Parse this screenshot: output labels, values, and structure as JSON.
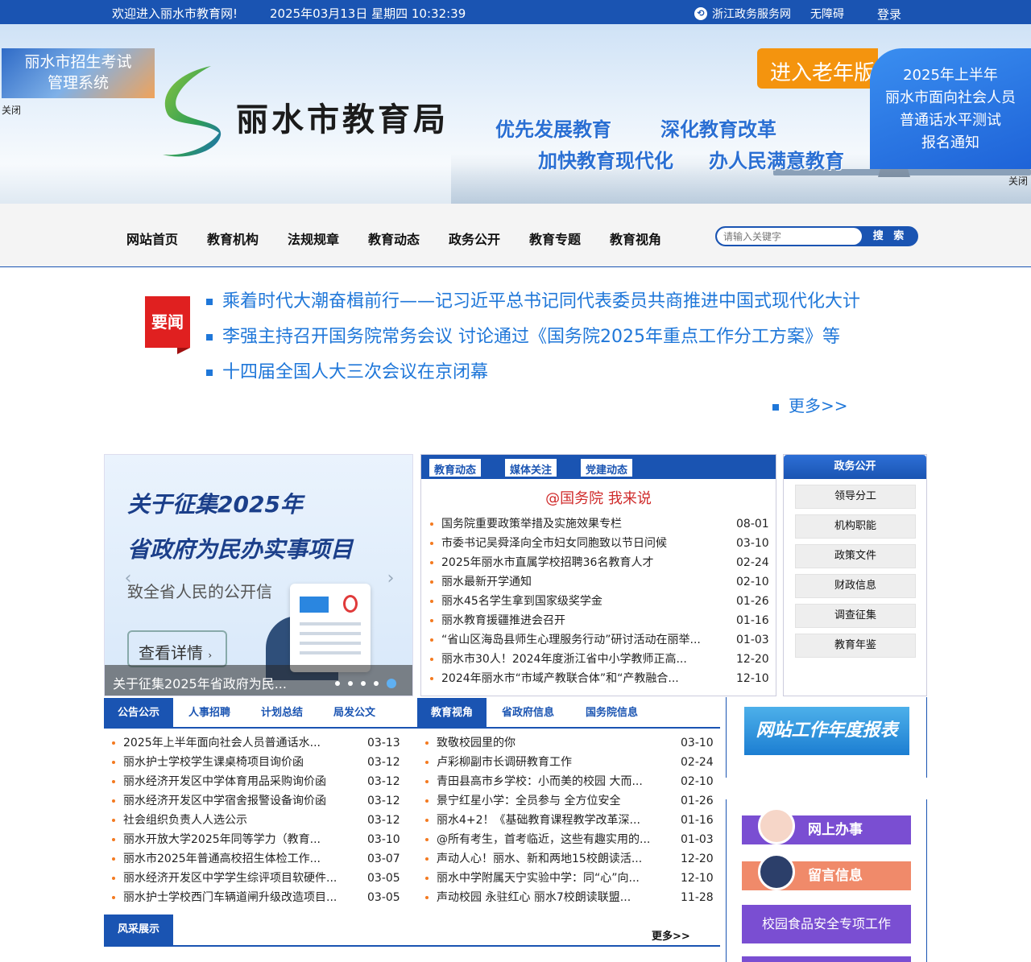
{
  "topbar": {
    "welcome": "欢迎进入丽水市教育网!",
    "datetime": "2025年03月13日 星期四 10:32:39",
    "zj_service": "浙江政务服务网",
    "accessibility": "无障碍",
    "login": "登录"
  },
  "banner": {
    "logo_text": "丽水市教育局",
    "slogans": [
      "优先发展教育",
      "深化教育改革",
      "加快教育现代化",
      "办人民满意教育"
    ],
    "old_version": "进入老年版",
    "float_left": {
      "line1": "丽水市招生考试",
      "line2": "管理系统",
      "close": "关闭"
    },
    "float_right": {
      "lines": [
        "2025年上半年",
        "丽水市面向社会人员",
        "普通话水平测试",
        "报名通知"
      ],
      "close": "关闭"
    }
  },
  "nav": {
    "items": [
      "网站首页",
      "教育机构",
      "法规规章",
      "教育动态",
      "政务公开",
      "教育专题",
      "教育视角"
    ],
    "search_placeholder": "请输入关键字",
    "search_button": "搜 索"
  },
  "news": {
    "tag": "要闻",
    "headlines": [
      "乘着时代大潮奋楫前行——记习近平总书记同代表委员共商推进中国式现代化大计",
      "李强主持召开国务院常务会议 讨论通过《国务院2025年重点工作分工方案》等",
      "十四届全国人大三次会议在京闭幕"
    ],
    "more": "更多>>"
  },
  "carousel": {
    "title1": "关于征集2025年",
    "title2": "省政府为民办实事项目",
    "subtitle": "致全省人民的公开信",
    "detail": "查看详情",
    "caption": "关于征集2025年省政府为民..."
  },
  "edu_panel": {
    "tabs": [
      "教育动态",
      "媒体关注",
      "党建动态"
    ],
    "highlight": "@国务院 我来说",
    "items": [
      {
        "title": "国务院重要政策举措及实施效果专栏",
        "date": "08-01"
      },
      {
        "title": "市委书记吴舜泽向全市妇女同胞致以节日问候",
        "date": "03-10"
      },
      {
        "title": "2025年丽水市直属学校招聘36名教育人才",
        "date": "02-24"
      },
      {
        "title": "丽水最新开学通知",
        "date": "02-10"
      },
      {
        "title": "丽水45名学生拿到国家级奖学金",
        "date": "01-26"
      },
      {
        "title": "丽水教育援疆推进会召开",
        "date": "01-16"
      },
      {
        "title": "“省山区海岛县师生心理服务行动”研讨活动在丽举...",
        "date": "01-03"
      },
      {
        "title": "丽水市30人！2024年度浙江省中小学教师正高...",
        "date": "12-20"
      },
      {
        "title": "2024年丽水市“市域产教联合体”和“产教融合...",
        "date": "12-10"
      }
    ]
  },
  "gov_panel": {
    "title": "政务公开",
    "buttons": [
      "领导分工",
      "机构职能",
      "政策文件",
      "财政信息",
      "调查征集",
      "教育年鉴"
    ]
  },
  "notice_panel": {
    "tabs": [
      "公告公示",
      "人事招聘",
      "计划总结",
      "局发公文"
    ],
    "items": [
      {
        "title": "2025年上半年面向社会人员普通话水...",
        "date": "03-13"
      },
      {
        "title": "丽水护士学校学生课桌椅项目询价函",
        "date": "03-12"
      },
      {
        "title": "丽水经济开发区中学体育用品采购询价函",
        "date": "03-12"
      },
      {
        "title": "丽水经济开发区中学宿舍报警设备询价函",
        "date": "03-12"
      },
      {
        "title": "社会组织负责人人选公示",
        "date": "03-12"
      },
      {
        "title": "丽水开放大学2025年同等学力（教育...",
        "date": "03-10"
      },
      {
        "title": "丽水市2025年普通高校招生体检工作...",
        "date": "03-07"
      },
      {
        "title": "丽水经济开发区中学学生综评项目软硬件...",
        "date": "03-05"
      },
      {
        "title": "丽水护士学校西门车辆道闸升级改造项目...",
        "date": "03-05"
      }
    ]
  },
  "view_panel": {
    "tabs": [
      "教育视角",
      "省政府信息",
      "国务院信息"
    ],
    "items": [
      {
        "title": "致敬校园里的你",
        "date": "03-10"
      },
      {
        "title": "卢彩柳副市长调研教育工作",
        "date": "02-24"
      },
      {
        "title": "青田县高市乡学校：小而美的校园 大而...",
        "date": "02-10"
      },
      {
        "title": "景宁红星小学：全员参与 全方位安全",
        "date": "01-26"
      },
      {
        "title": "丽水4+2！《基础教育课程教学改革深...",
        "date": "01-16"
      },
      {
        "title": "@所有考生，首考临近，这些有趣实用的...",
        "date": "01-03"
      },
      {
        "title": "声动人心！丽水、新和两地15校朗读活...",
        "date": "12-20"
      },
      {
        "title": "丽水中学附属天宁实验中学：同“心”向...",
        "date": "12-10"
      },
      {
        "title": "声动校园 永驻红心 丽水7校朗读联盟...",
        "date": "11-28"
      }
    ]
  },
  "side": {
    "report": "网站工作年度报表",
    "online": "网上办事",
    "message": "留言信息",
    "food_safety": "校园食品安全专项工作"
  },
  "fengcai": {
    "title": "风采展示",
    "more": "更多>>"
  }
}
